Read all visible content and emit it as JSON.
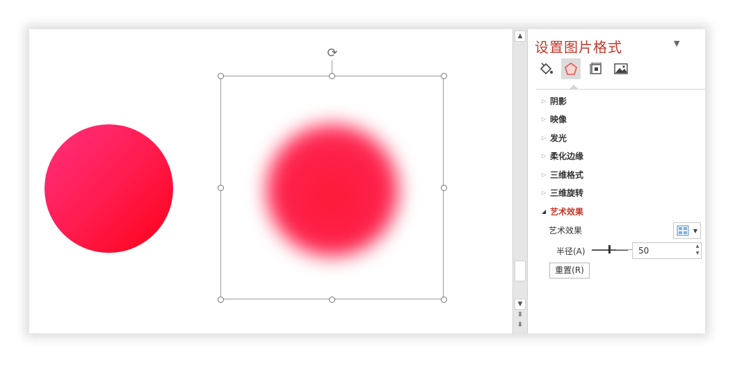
{
  "canvas": {
    "rotate_icon": "rotate-icon",
    "shape_left_colors": [
      "#ff3080",
      "#ff0018"
    ],
    "shape_right_color": "#ff1a36"
  },
  "panel": {
    "title": "设置图片格式",
    "menu_icon": "dropdown-arrow-icon",
    "tabs": [
      {
        "name": "fill-line-icon",
        "active": false
      },
      {
        "name": "effects-pentagon-icon",
        "active": true
      },
      {
        "name": "size-properties-icon",
        "active": false
      },
      {
        "name": "picture-icon",
        "active": false
      }
    ],
    "sections": [
      {
        "label": "阴影",
        "open": false
      },
      {
        "label": "映像",
        "open": false
      },
      {
        "label": "发光",
        "open": false
      },
      {
        "label": "柔化边缘",
        "open": false
      },
      {
        "label": "三维格式",
        "open": false
      },
      {
        "label": "三维旋转",
        "open": false
      },
      {
        "label": "艺术效果",
        "open": true
      }
    ],
    "artistic": {
      "effect_label": "艺术效果",
      "radius_label": "半径(A)",
      "radius_value": "50",
      "reset_label": "重置(R)"
    },
    "accent_color": "#c0392b"
  }
}
